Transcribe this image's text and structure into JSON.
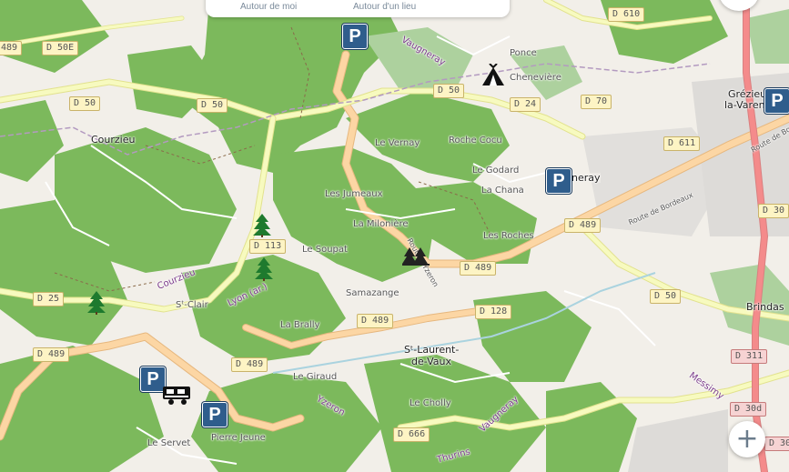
{
  "search_tabs": [
    "Autour de moi",
    "Autour d'un lieu"
  ],
  "zoom_in_label": "+",
  "towns": [
    "Courzieu",
    "Grézieu-",
    "la-Varenne",
    "Brindas",
    "Sᵗ-Laurent-",
    "de-Vaux",
    "Vaugneray"
  ],
  "places": [
    "Ponce",
    "Chenevière",
    "Le Vernay",
    "Roche Cocu",
    "Le Godard",
    "La Chana",
    "Les Jumeaux",
    "La Milonière",
    "Les Roches",
    "Le Soupat",
    "Sᵗ-Clair",
    "Samazange",
    "La Brally",
    "Le Giraud",
    "Le Cholly",
    "Le Servet",
    "Pierre Jeune"
  ],
  "streets": [
    "Vaugneray",
    "Courzieu",
    "Lyon (ar.)",
    "Route de Bordeaux",
    "Route de Bo",
    "Route d'Yzeron",
    "Yzeron",
    "Vaugneray",
    "Messimy",
    "Thurins"
  ],
  "roads": [
    "D 610",
    "D 50E",
    "D 50",
    "D 50",
    "D 50",
    "D 24",
    "D 70",
    "D 611",
    "D 113",
    "D 489",
    "D 25",
    "D 489",
    "D 489",
    "D 489",
    "D 489",
    "D 128",
    "D 50",
    "D 30",
    "D 311",
    "D 30d",
    "D 30d",
    "D 666",
    "489"
  ],
  "colors": {
    "forest": "#7cb95c",
    "wood": "#add19e",
    "major_road": "#fcd6a4",
    "secondary": "#f7fabf",
    "parking": "#2f5d8c",
    "urban": "#e0dfdf",
    "primary": "#f48b8b"
  }
}
